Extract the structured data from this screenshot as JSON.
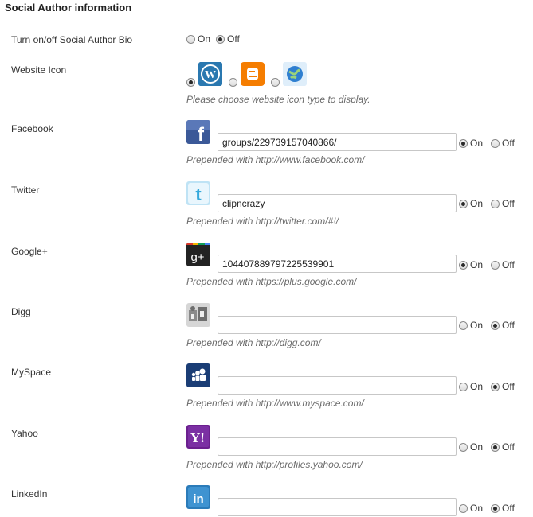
{
  "heading": "Social Author information",
  "bio": {
    "label": "Turn on/off Social Author Bio",
    "on": "On",
    "off": "Off",
    "selected": "off"
  },
  "website_icon": {
    "label": "Website Icon",
    "hint": "Please choose website icon type to display.",
    "options": [
      {
        "icon": "wordpress-icon",
        "selected": true
      },
      {
        "icon": "blogger-icon",
        "selected": false
      },
      {
        "icon": "globe-icon",
        "selected": false
      }
    ]
  },
  "networks": [
    {
      "label": "Facebook",
      "icon": "facebook-icon",
      "value": "groups/229739157040866/",
      "hint": "Prepended with http://www.facebook.com/",
      "on": "On",
      "off": "Off",
      "selected": "on"
    },
    {
      "label": "Twitter",
      "icon": "twitter-icon",
      "value": "clipncrazy",
      "hint": "Prepended with http://twitter.com/#!/",
      "on": "On",
      "off": "Off",
      "selected": "on"
    },
    {
      "label": "Google+",
      "icon": "google-plus-icon",
      "value": "104407889797225539901",
      "hint": "Prepended with https://plus.google.com/",
      "on": "On",
      "off": "Off",
      "selected": "on"
    },
    {
      "label": "Digg",
      "icon": "digg-icon",
      "value": "",
      "hint": "Prepended with http://digg.com/",
      "on": "On",
      "off": "Off",
      "selected": "off"
    },
    {
      "label": "MySpace",
      "icon": "myspace-icon",
      "value": "",
      "hint": "Prepended with http://www.myspace.com/",
      "on": "On",
      "off": "Off",
      "selected": "off"
    },
    {
      "label": "Yahoo",
      "icon": "yahoo-icon",
      "value": "",
      "hint": "Prepended with http://profiles.yahoo.com/",
      "on": "On",
      "off": "Off",
      "selected": "off"
    },
    {
      "label": "LinkedIn",
      "icon": "linkedin-icon",
      "value": "",
      "on": "On",
      "off": "Off",
      "selected": "off"
    }
  ]
}
